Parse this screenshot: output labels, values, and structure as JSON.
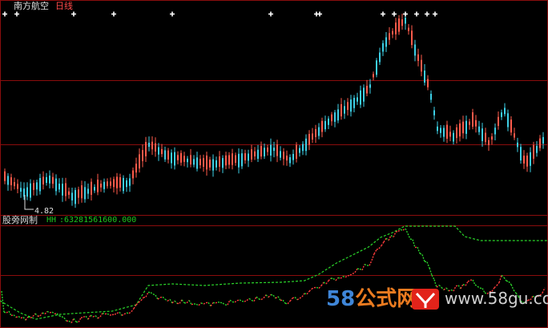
{
  "header": {
    "stock_name": "南方航空",
    "period": "日线"
  },
  "indicator": {
    "name": "股旁网制",
    "var_name": "HH",
    "separator": ":",
    "value": "63281561600.000"
  },
  "price_annotation": {
    "low_label": "4.82",
    "low_value": 4.82
  },
  "watermark": {
    "number": "58",
    "cn": "公式网",
    "url": "www.58gu.com"
  },
  "colors": {
    "up": "#ff5a4a",
    "down": "#3ccfe6",
    "grid": "#8a0d0d",
    "signal": "#ffffff",
    "line_green": "#2ad42a",
    "line_red": "#ff3c3c"
  },
  "signals": {
    "icon": "plus-icon",
    "count": 13
  }
}
